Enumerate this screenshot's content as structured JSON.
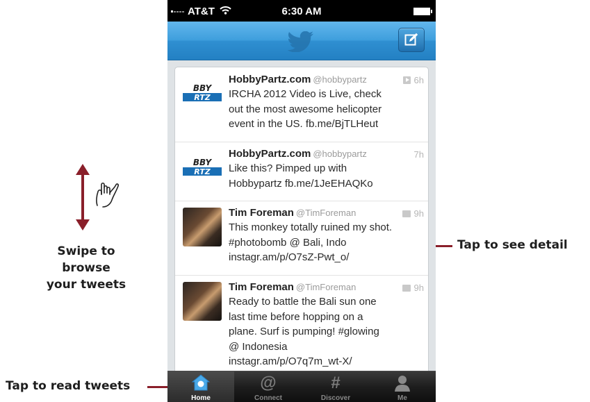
{
  "status_bar": {
    "carrier": "AT&T",
    "time": "6:30 AM"
  },
  "nav_bar": {
    "logo_icon": "twitter-bird-icon",
    "compose_icon": "compose-icon"
  },
  "tweets": [
    {
      "name": "HobbyPartz.com",
      "handle": "@hobbypartz",
      "time": "6h",
      "media": "video",
      "lines": [
        "IRCHA 2012 Video is Live, check",
        "out the most awesome helicopter",
        "event in the US. fb.me/BjTLHeut"
      ]
    },
    {
      "name": "HobbyPartz.com",
      "handle": "@hobbypartz",
      "time": "7h",
      "media": "",
      "lines": [
        "Like this? Pimped up with",
        "Hobbypartz fb.me/1JeEHAQKo"
      ]
    },
    {
      "name": "Tim Foreman",
      "handle": "@TimForeman",
      "time": "9h",
      "media": "photo",
      "lines": [
        "This monkey totally ruined my shot.",
        "#photobomb  @ Bali, Indo",
        "instagr.am/p/O7sZ-Pwt_o/"
      ]
    },
    {
      "name": "Tim Foreman",
      "handle": "@TimForeman",
      "time": "9h",
      "media": "photo",
      "lines": [
        "Ready to battle the Bali sun one",
        "last time before hopping on a",
        "plane. Surf is pumping! #glowing",
        "@ Indonesia",
        "instagr.am/p/O7q7m_wt-X/"
      ]
    }
  ],
  "tab_bar": [
    {
      "label": "Home",
      "icon": "home-icon",
      "active": true
    },
    {
      "label": "Connect",
      "icon": "at-icon",
      "glyph": "@",
      "active": false
    },
    {
      "label": "Discover",
      "icon": "hash-icon",
      "glyph": "#",
      "active": false
    },
    {
      "label": "Me",
      "icon": "person-icon",
      "active": false
    }
  ],
  "callouts": {
    "swipe_lines": [
      "Swipe to",
      "browse",
      "your tweets"
    ],
    "tap_detail": "Tap to see detail",
    "tap_read": "Tap to read tweets"
  },
  "colors": {
    "accent": "#2f8fd1",
    "callout_line": "#8a1f2a"
  }
}
